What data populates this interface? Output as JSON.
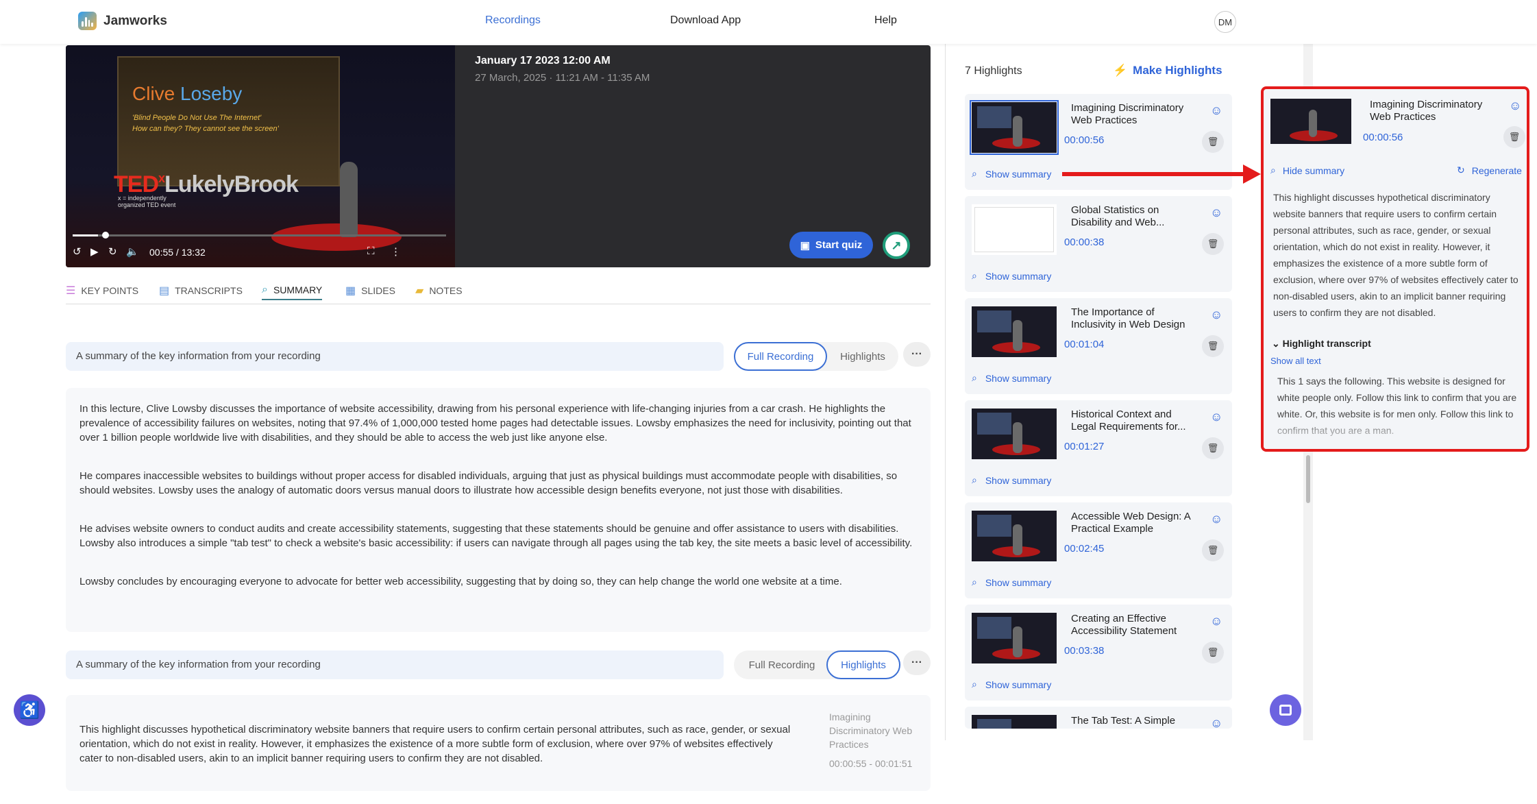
{
  "header": {
    "app_name": "Jamworks",
    "nav": [
      "Recordings",
      "Download App",
      "Help"
    ],
    "avatar_initials": "DM"
  },
  "video": {
    "slide_title_1": "Clive ",
    "slide_title_2": "Loseby",
    "slide_line1": "'Blind People Do Not Use The Internet'",
    "slide_line2": "How can they? They cannot see the screen'",
    "brand_red": "TED",
    "brand_x": "x",
    "brand_name": "LukelyBrook",
    "brand_sub1": "x = independently",
    "brand_sub2": "organized TED event",
    "time": "00:55 / 13:32",
    "progress": 0.068,
    "date": "January 17 2023 12:00 AM",
    "sub": "27 March, 2025 · 11:21 AM - 11:35 AM",
    "quiz": "Start quiz"
  },
  "tabs": [
    {
      "label": "KEY POINTS",
      "icon": "list-icon"
    },
    {
      "label": "TRANSCRIPTS",
      "icon": "chat-icon"
    },
    {
      "label": "SUMMARY",
      "icon": "search-icon"
    },
    {
      "label": "SLIDES",
      "icon": "slides-icon"
    },
    {
      "label": "NOTES",
      "icon": "notes-icon"
    }
  ],
  "summary": {
    "bar_text": "A summary of the key information from your recording",
    "full": "Full Recording",
    "highlights": "Highlights",
    "more": "···",
    "paragraphs": [
      "In this lecture, Clive Lowsby discusses the importance of website accessibility, drawing from his personal experience with life-changing injuries from a car crash. He highlights the prevalence of accessibility failures on websites, noting that 97.4% of 1,000,000 tested home pages had detectable issues. Lowsby emphasizes the need for inclusivity, pointing out that over 1 billion people worldwide live with disabilities, and they should be able to access the web just like anyone else.",
      "He compares inaccessible websites to buildings without proper access for disabled individuals, arguing that just as physical buildings must accommodate people with disabilities, so should websites. Lowsby uses the analogy of automatic doors versus manual doors to illustrate how accessible design benefits everyone, not just those with disabilities.",
      "He advises website owners to conduct audits and create accessibility statements, suggesting that these statements should be genuine and offer assistance to users with disabilities. Lowsby also introduces a simple \"tab test\" to check a website's basic accessibility: if users can navigate through all pages using the tab key, the site meets a basic level of accessibility.",
      "Lowsby concludes by encouraging everyone to advocate for better web accessibility, suggesting that by doing so, they can help change the world one website at a time."
    ],
    "hl_text": "This highlight discusses hypothetical discriminatory website banners that require users to confirm certain personal attributes, such as race, gender, or sexual orientation, which do not exist in reality. However, it emphasizes the existence of a more subtle form of exclusion, where over 97% of websites effectively cater to non-disabled users, akin to an implicit banner requiring users to confirm they are not disabled.",
    "hl_title": "Imagining Discriminatory Web Practices",
    "hl_range": "00:00:55 - 00:01:51"
  },
  "highlights": {
    "count": "7 Highlights",
    "make": "Make Highlights",
    "show": "Show summary",
    "items": [
      {
        "title": "Imagining Discriminatory Web Practices",
        "time": "00:00:56"
      },
      {
        "title": "Global Statistics on Disability and Web...",
        "time": "00:00:38"
      },
      {
        "title": "The Importance of Inclusivity in Web Design",
        "time": "00:01:04"
      },
      {
        "title": "Historical Context and Legal Requirements for...",
        "time": "00:01:27"
      },
      {
        "title": "Accessible Web Design: A Practical Example",
        "time": "00:02:45"
      },
      {
        "title": "Creating an Effective Accessibility Statement",
        "time": "00:03:38"
      },
      {
        "title": "The Tab Test: A Simple",
        "time": ""
      }
    ]
  },
  "popup": {
    "title": "Imagining Discriminatory Web Practices",
    "time": "00:00:56",
    "hide": "Hide summary",
    "regen": "Regenerate",
    "text": "This highlight discusses hypothetical discriminatory website banners that require users to confirm certain personal attributes, such as race, gender, or sexual orientation, which do not exist in reality. However, it emphasizes the existence of a more subtle form of exclusion, where over 97% of websites effectively cater to non-disabled users, akin to an implicit banner requiring users to confirm they are not disabled.",
    "transcript_label": "Highlight transcript",
    "show_all": "Show all text",
    "transcript": "This 1 says the following.  This website is designed for white people only.  Follow this link to confirm that you are white.  Or, this website is for men only.  Follow this link to confirm that you are a man."
  }
}
